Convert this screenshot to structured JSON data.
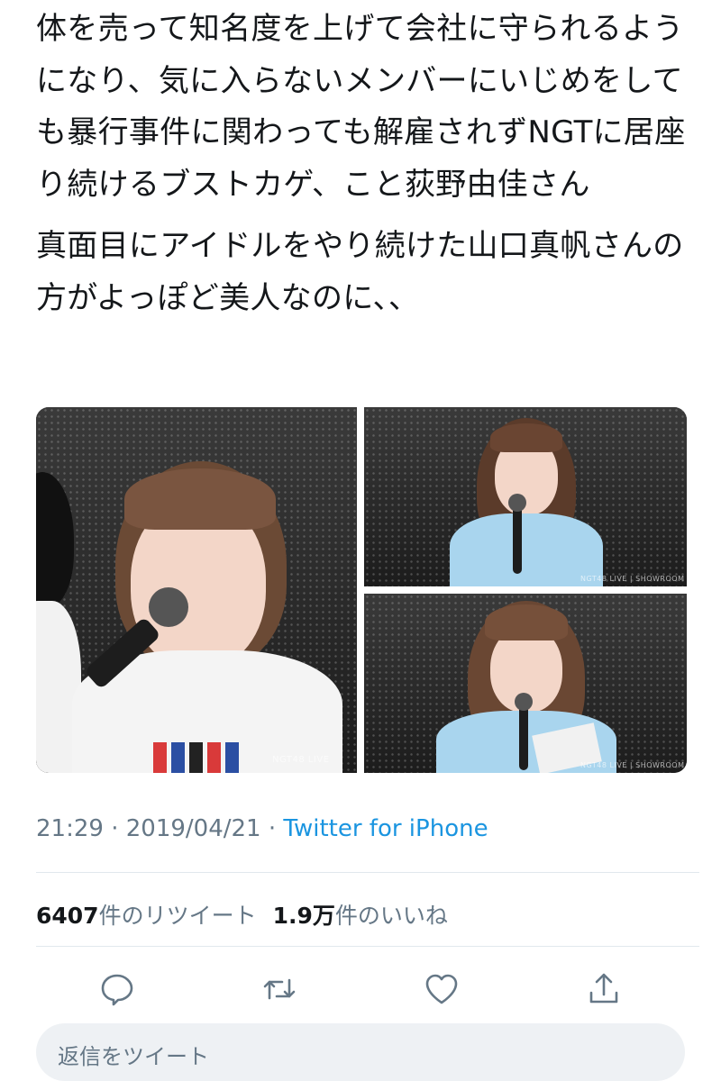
{
  "tweet": {
    "paragraph1": "体を売って知名度を上げて会社に守られるようになり、気に入らないメンバーにいじめをしても暴行事件に関わっても解雇されずNGTに居座り続けるブストカゲ、こと荻野由佳さん",
    "paragraph2": "真面目にアイドルをやり続けた山口真帆さんの方がよっぽど美人なのに、、"
  },
  "media": {
    "watermark_left": "NGT48 LIVE",
    "watermark_right_top": "NGT48 LIVE | SHOWROOM",
    "watermark_right_bottom": "NGT48 LIVE | SHOWROOM"
  },
  "meta": {
    "time": "21:29",
    "separator": " · ",
    "date": "2019/04/21",
    "separator2": " · ",
    "source": "Twitter for iPhone"
  },
  "stats": {
    "retweets_count": "6407",
    "retweets_label": "件のリツイート",
    "likes_count": "1.9万",
    "likes_label": "件のいいね"
  },
  "actions": {
    "reply_icon": "reply-icon",
    "retweet_icon": "retweet-icon",
    "like_icon": "heart-icon",
    "share_icon": "share-icon"
  },
  "reply": {
    "placeholder": "返信をツイート"
  },
  "colors": {
    "text": "#14171a",
    "muted": "#657786",
    "link": "#1b95e0",
    "divider": "#e1e8ed",
    "reply_bg": "#eef1f4"
  }
}
